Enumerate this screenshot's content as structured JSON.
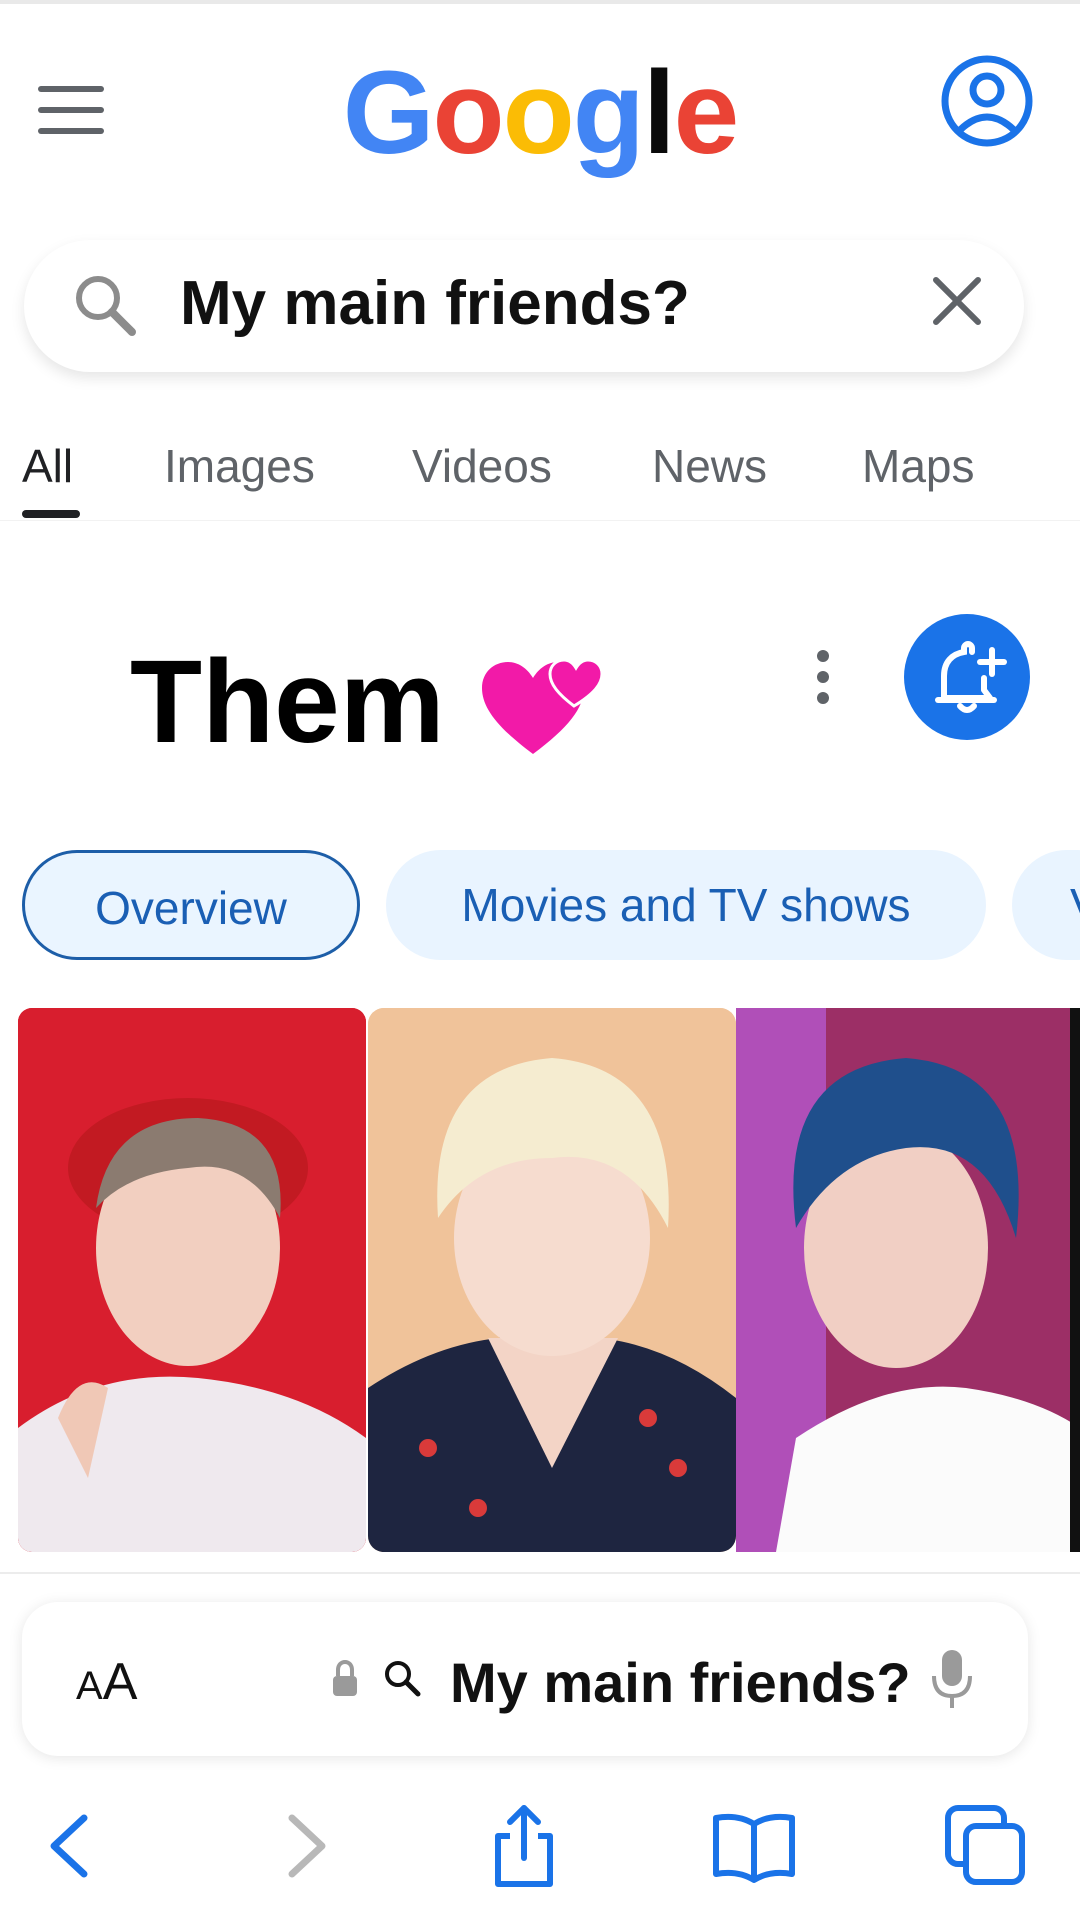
{
  "header": {
    "logo": [
      "G",
      "o",
      "o",
      "g",
      "l",
      "e"
    ],
    "menu_icon": "hamburger-menu-icon",
    "account_icon": "account-circle-icon"
  },
  "search": {
    "query": "My main friends?",
    "search_icon": "magnifier-icon",
    "clear_icon": "close-icon"
  },
  "tabs": [
    {
      "label": "All",
      "active": true
    },
    {
      "label": "Images",
      "active": false
    },
    {
      "label": "Videos",
      "active": false
    },
    {
      "label": "News",
      "active": false
    },
    {
      "label": "Maps",
      "active": false
    }
  ],
  "result": {
    "title": "Them",
    "emoji": "💕",
    "more_icon": "vertical-dots-icon",
    "follow_icon": "bell-plus-icon"
  },
  "chips": [
    {
      "label": "Overview",
      "selected": true
    },
    {
      "label": "Movies and TV shows",
      "selected": false
    },
    {
      "label": "V",
      "selected": false
    }
  ],
  "photos": [
    {
      "alt_name": "photo-red-background"
    },
    {
      "alt_name": "photo-blonde-hair"
    },
    {
      "alt_name": "photo-blue-hair"
    }
  ],
  "browser": {
    "text_size_label_small": "A",
    "text_size_label_large": "A",
    "lock_icon": "lock-icon",
    "address_query": "My main friends?",
    "mic_icon": "microphone-icon"
  },
  "toolbar": {
    "back_icon": "chevron-left-icon",
    "forward_icon": "chevron-right-icon",
    "share_icon": "share-icon",
    "bookmarks_icon": "open-book-icon",
    "tabs_icon": "tabs-icon"
  },
  "colors": {
    "google_blue": "#4285F4",
    "google_red": "#EA4335",
    "google_yellow": "#FBBC05",
    "link_blue": "#1a73e8",
    "chip_bg": "#e9f4ff"
  }
}
